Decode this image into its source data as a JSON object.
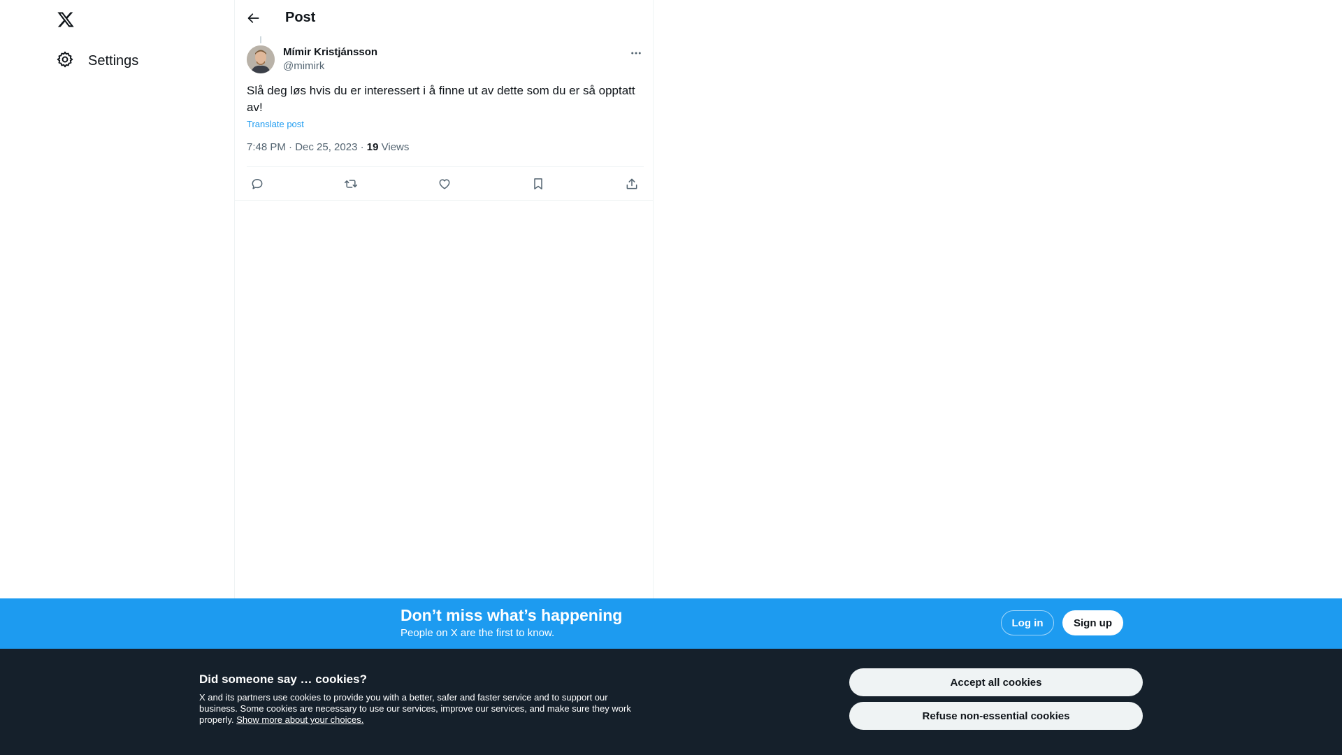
{
  "sidebar": {
    "logo_icon": "x-logo-icon",
    "items": [
      {
        "label": "Settings",
        "icon": "gear-icon"
      }
    ]
  },
  "header": {
    "back_icon": "arrow-left-icon",
    "title": "Post"
  },
  "post": {
    "author": {
      "name": "Mímir Kristjánsson",
      "handle": "@mimirk"
    },
    "text": "Slå deg løs hvis du er interessert i å finne ut av dette som du er så opptatt av!",
    "translate_label": "Translate post",
    "timestamp": "7:48 PM · Dec 25, 2023",
    "separator": " · ",
    "views_count": "19",
    "views_label": " Views",
    "actions": [
      {
        "name": "reply",
        "icon": "reply-icon"
      },
      {
        "name": "repost",
        "icon": "repost-icon"
      },
      {
        "name": "like",
        "icon": "heart-icon"
      },
      {
        "name": "bookmark",
        "icon": "bookmark-icon"
      },
      {
        "name": "share",
        "icon": "share-icon"
      }
    ]
  },
  "banner": {
    "title": "Don’t miss what’s happening",
    "subtitle": "People on X are the first to know.",
    "login_label": "Log in",
    "signup_label": "Sign up",
    "background": "#1d9bf0"
  },
  "cookies": {
    "title": "Did someone say … cookies?",
    "text": "X and its partners use cookies to provide you with a better, safer and faster service and to support our business. Some cookies are necessary to use our services, improve our services, and make sure they work properly. ",
    "link_label": "Show more about your choices.",
    "accept_label": "Accept all cookies",
    "refuse_label": "Refuse non-essential cookies",
    "background": "#15202b"
  },
  "colors": {
    "accent": "#1d9bf0",
    "text_primary": "#0f1419",
    "text_secondary": "#536471"
  }
}
